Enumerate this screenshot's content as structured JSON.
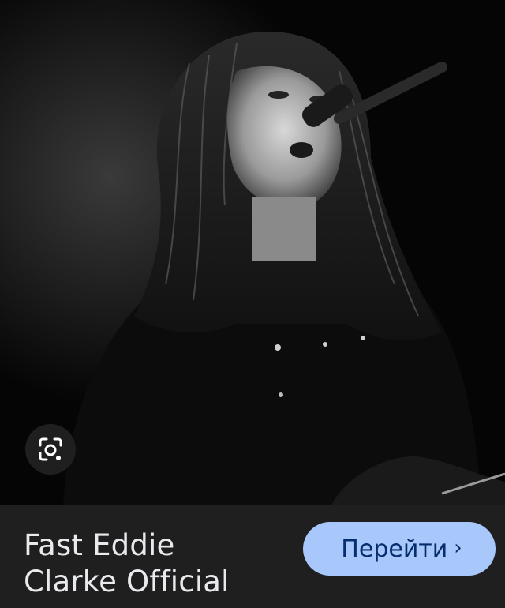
{
  "result": {
    "title": "Fast Eddie\nClarke Official",
    "visit_label": "Перейти",
    "visit_chevron": "›"
  },
  "photo": {
    "description_icon": "concert-photo-image"
  },
  "lens": {
    "icon": "google-lens-icon"
  },
  "colors": {
    "panel_bg": "#1f1f1f",
    "button_bg": "#a8c7fa",
    "button_text": "#062e6f",
    "title_text": "#e8eaed"
  }
}
